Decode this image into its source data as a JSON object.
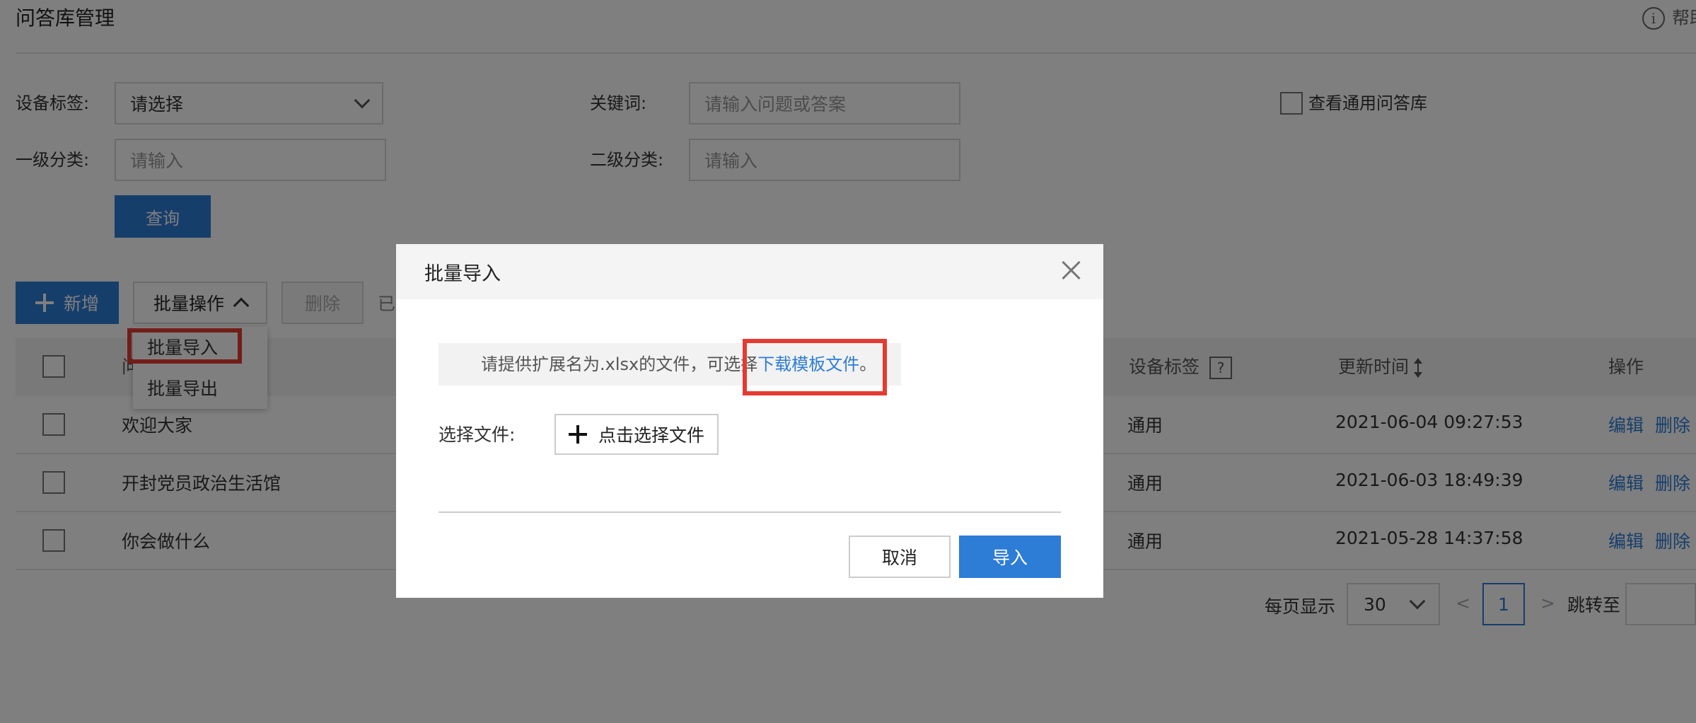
{
  "header": {
    "title": "问答库管理",
    "help_label": "帮助",
    "help_icon": "info-icon"
  },
  "filters": {
    "device_tag_label": "设备标签:",
    "device_tag_value": "请选择",
    "keyword_label": "关键词:",
    "keyword_placeholder": "请输入问题或答案",
    "general_checkbox_label": "查看通用问答库",
    "level1_label": "一级分类:",
    "level1_placeholder": "请输入",
    "level2_label": "二级分类:",
    "level2_placeholder": "请输入",
    "query_button": "查询"
  },
  "toolbar": {
    "add_button": "新增",
    "batch_button": "批量操作",
    "delete_button": "删除",
    "selected_text": "已"
  },
  "batch_menu": {
    "items": [
      "批量导入",
      "批量导出"
    ]
  },
  "table": {
    "columns": {
      "question": "问",
      "device_tag": "设备标签",
      "device_tag_help": "?",
      "updated": "更新时间",
      "actions": "操作"
    },
    "rows": [
      {
        "question": "欢迎大家",
        "device_tag": "通用",
        "updated": "2021-06-04 09:27:53",
        "edit": "编辑",
        "delete": "删除"
      },
      {
        "question": "开封党员政治生活馆",
        "device_tag": "通用",
        "updated": "2021-06-03 18:49:39",
        "edit": "编辑",
        "delete": "删除"
      },
      {
        "question": "你会做什么",
        "device_tag": "通用",
        "updated": "2021-05-28 14:37:58",
        "edit": "编辑",
        "delete": "删除"
      }
    ]
  },
  "pagination": {
    "per_page_label": "每页显示",
    "per_page_value": "30",
    "prev": "<",
    "current": "1",
    "next": ">",
    "jump_label": "跳转至"
  },
  "modal": {
    "title": "批量导入",
    "notice_text": "请提供扩展名为.xlsx的文件，可选择",
    "notice_link": "下载模板文件",
    "notice_end": "。",
    "file_label": "选择文件:",
    "file_button": "点击选择文件",
    "cancel_button": "取消",
    "import_button": "导入"
  },
  "colors": {
    "primary": "#2d7cd6",
    "highlight": "#e53a31",
    "overlay": "rgba(0,0,0,0.5)"
  }
}
